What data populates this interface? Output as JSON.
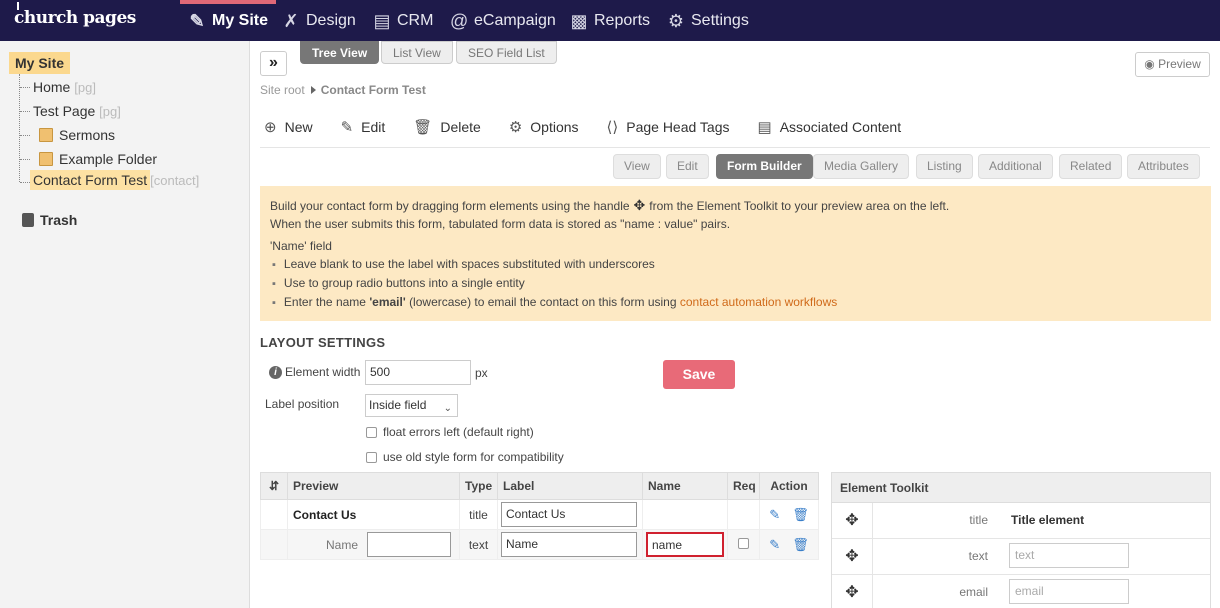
{
  "nav": {
    "logo": "church pages",
    "items": [
      {
        "label": "My Site",
        "icon": "site-edit-icon"
      },
      {
        "label": "Design",
        "icon": "design-tools-icon"
      },
      {
        "label": "CRM",
        "icon": "contact-card-icon"
      },
      {
        "label": "eCampaign",
        "icon": "at-sign-icon"
      },
      {
        "label": "Reports",
        "icon": "bar-chart-icon"
      },
      {
        "label": "Settings",
        "icon": "gear-icon"
      }
    ],
    "active_accent": "#e06877",
    "bg": "#1e1a4a"
  },
  "sidebar": {
    "root": "My Site",
    "items": [
      {
        "label": "Home",
        "meta": "[pg]"
      },
      {
        "label": "Test Page",
        "meta": "[pg]"
      },
      {
        "label": "Sermons",
        "meta": ""
      },
      {
        "label": "Example Folder",
        "meta": ""
      },
      {
        "label": "Contact Form Test",
        "meta": "[contact]"
      }
    ],
    "trash": "Trash"
  },
  "view_tabs": [
    "Tree View",
    "List View",
    "SEO Field List"
  ],
  "preview_label": "Preview",
  "breadcrumb": {
    "root": "Site root",
    "current": "Contact Form Test"
  },
  "actions": [
    "New",
    "Edit",
    "Delete",
    "Options",
    "Page Head Tags",
    "Associated Content"
  ],
  "sub_tabs": [
    "View",
    "Edit",
    "Form Builder",
    "Media Gallery",
    "Listing",
    "Additional",
    "Related",
    "Attributes"
  ],
  "info": {
    "line1_a": "Build your contact form by dragging form elements using the handle",
    "line1_b": "from the Element Toolkit to your preview area on the left.",
    "line2": "When the user submits this form, tabulated form data is stored as \"name : value\" pairs.",
    "name_field": "'Name' field",
    "bullet1": "Leave blank to use the label with spaces substituted with underscores",
    "bullet2": "Use to group radio buttons into a single entity",
    "bullet3_a": "Enter the name",
    "bullet3_b": "'email'",
    "bullet3_c": "(lowercase) to email the contact on this form using",
    "bullet3_link": "contact automation workflows"
  },
  "layout": {
    "title": "LAYOUT SETTINGS",
    "element_width_label": "Element width",
    "element_width_value": "500",
    "px": "px",
    "label_position_label": "Label position",
    "label_position_value": "Inside field",
    "float_errors": "float errors left (default right)",
    "old_style": "use old style form for compatibility",
    "save": "Save",
    "save_color": "#e86a78"
  },
  "form_table": {
    "headers": [
      "Preview",
      "Type",
      "Label",
      "Name",
      "Req",
      "Action"
    ],
    "rows": [
      {
        "preview": "Contact Us",
        "type": "title",
        "label": "Contact Us",
        "name": ""
      },
      {
        "preview": "Name",
        "type": "text",
        "label": "Name",
        "name": "name"
      }
    ]
  },
  "toolkit": {
    "title": "Element Toolkit",
    "rows": [
      {
        "type": "title",
        "value": "Title element"
      },
      {
        "type": "text",
        "placeholder": "text"
      },
      {
        "type": "email",
        "placeholder": "email"
      }
    ]
  }
}
